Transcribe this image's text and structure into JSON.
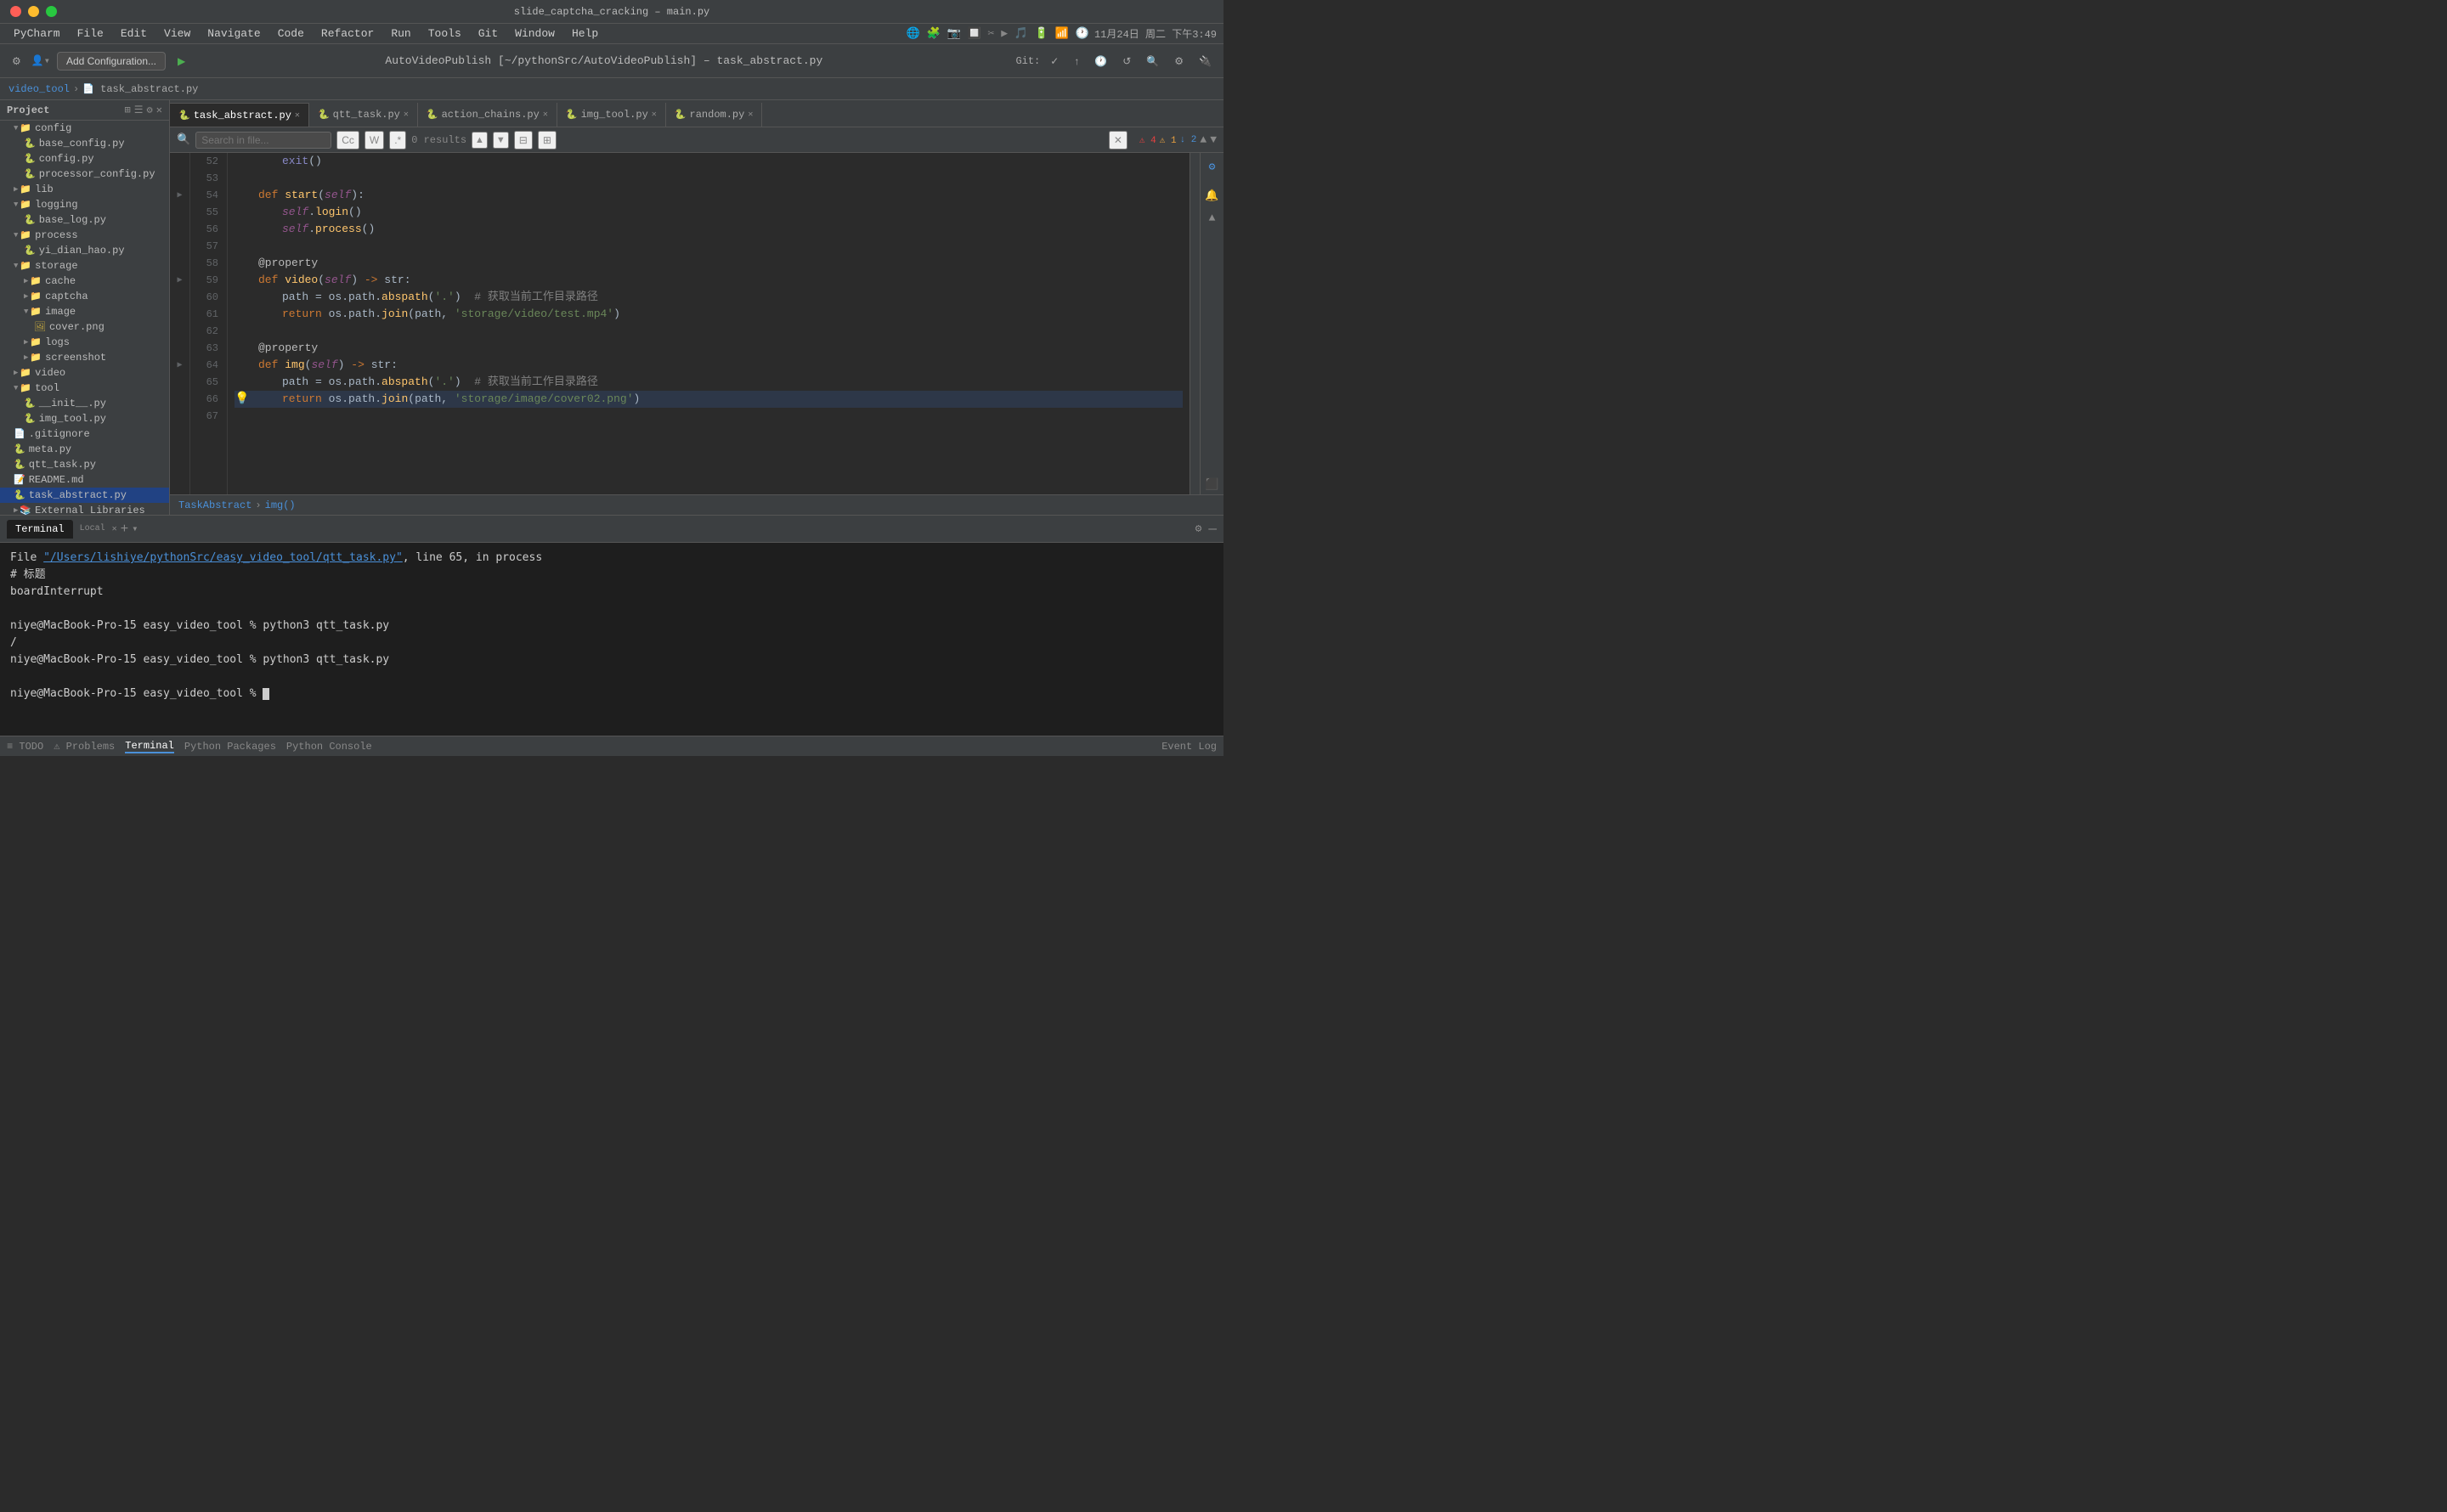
{
  "window": {
    "title": "slide_captcha_cracking – main.py",
    "subtitle": "AutoVideoPublish [~/pythonSrc/AutoVideoPublish] – task_abstract.py"
  },
  "menubar": {
    "app": "PyCharm",
    "items": [
      "File",
      "Edit",
      "View",
      "Navigate",
      "Code",
      "Refactor",
      "Run",
      "Tools",
      "Git",
      "Window",
      "Help"
    ]
  },
  "toolbar": {
    "title": "AutoVideoPublish [~/pythonSrc/AutoVideoPublish] – task_abstract.py",
    "config_label": "Add Configuration...",
    "git_label": "Git:"
  },
  "breadcrumb": {
    "parent": "video_tool",
    "current": "task_abstract.py"
  },
  "tabs": [
    {
      "label": "task_abstract.py",
      "active": true
    },
    {
      "label": "qtt_task.py",
      "active": false
    },
    {
      "label": "action_chains.py",
      "active": false
    },
    {
      "label": "img_tool.py",
      "active": false
    },
    {
      "label": "random.py",
      "active": false
    }
  ],
  "search": {
    "placeholder": "🔍",
    "results": "0 results"
  },
  "sidebar": {
    "project_label": "Project",
    "items": [
      {
        "indent": 1,
        "type": "folder-open",
        "label": "config",
        "depth": 1
      },
      {
        "indent": 2,
        "type": "file-py",
        "label": "base_config.py",
        "depth": 2
      },
      {
        "indent": 2,
        "type": "file-py",
        "label": "config.py",
        "depth": 2
      },
      {
        "indent": 2,
        "type": "file-py",
        "label": "processor_config.py",
        "depth": 2
      },
      {
        "indent": 1,
        "type": "folder-closed",
        "label": "lib",
        "depth": 1
      },
      {
        "indent": 1,
        "type": "folder-open",
        "label": "logging",
        "depth": 1
      },
      {
        "indent": 2,
        "type": "file-py",
        "label": "base_log.py",
        "depth": 2
      },
      {
        "indent": 1,
        "type": "folder-open",
        "label": "process",
        "depth": 1
      },
      {
        "indent": 2,
        "type": "file-py",
        "label": "yi_dian_hao.py",
        "depth": 2
      },
      {
        "indent": 1,
        "type": "folder-open",
        "label": "storage",
        "depth": 1
      },
      {
        "indent": 2,
        "type": "folder-closed",
        "label": "cache",
        "depth": 2
      },
      {
        "indent": 2,
        "type": "folder-closed",
        "label": "captcha",
        "depth": 2
      },
      {
        "indent": 2,
        "type": "folder-open",
        "label": "image",
        "depth": 2
      },
      {
        "indent": 3,
        "type": "file-img",
        "label": "cover.png",
        "depth": 3
      },
      {
        "indent": 2,
        "type": "folder-closed",
        "label": "logs",
        "depth": 2
      },
      {
        "indent": 2,
        "type": "folder-closed",
        "label": "screenshot",
        "depth": 2
      },
      {
        "indent": 1,
        "type": "folder-closed",
        "label": "video",
        "depth": 1
      },
      {
        "indent": 1,
        "type": "folder-open",
        "label": "tool",
        "depth": 1
      },
      {
        "indent": 2,
        "type": "file-py",
        "label": "__init__.py",
        "depth": 2
      },
      {
        "indent": 2,
        "type": "file-py",
        "label": "img_tool.py",
        "depth": 2
      },
      {
        "indent": 1,
        "type": "file-git",
        "label": ".gitignore",
        "depth": 1
      },
      {
        "indent": 1,
        "type": "file-py",
        "label": "meta.py",
        "depth": 1
      },
      {
        "indent": 1,
        "type": "file-py",
        "label": "qtt_task.py",
        "depth": 1
      },
      {
        "indent": 1,
        "type": "file-md",
        "label": "README.md",
        "depth": 1
      },
      {
        "indent": 1,
        "type": "file-py",
        "label": "task_abstract.py",
        "depth": 1,
        "selected": true
      },
      {
        "indent": 1,
        "type": "folder-closed",
        "label": "External Libraries",
        "depth": 1
      }
    ]
  },
  "code": {
    "lines": [
      {
        "num": 52,
        "content": "        exit()"
      },
      {
        "num": 53,
        "content": ""
      },
      {
        "num": 54,
        "content": "    def start(self):"
      },
      {
        "num": 55,
        "content": "        self.login()"
      },
      {
        "num": 56,
        "content": "        self.process()"
      },
      {
        "num": 57,
        "content": ""
      },
      {
        "num": 58,
        "content": "    @property"
      },
      {
        "num": 59,
        "content": "    def video(self) -> str:"
      },
      {
        "num": 60,
        "content": "        path = os.path.abspath('.')  # 获取当前工作目录路径"
      },
      {
        "num": 61,
        "content": "        return os.path.join(path, 'storage/video/test.mp4')"
      },
      {
        "num": 62,
        "content": ""
      },
      {
        "num": 63,
        "content": "    @property"
      },
      {
        "num": 64,
        "content": "    def img(self) -> str:"
      },
      {
        "num": 65,
        "content": "        path = os.path.abspath('.')  # 获取当前工作目录路径"
      },
      {
        "num": 66,
        "content": "        return os.path.join(path, 'storage/image/cover02.png')"
      },
      {
        "num": 67,
        "content": ""
      }
    ]
  },
  "status_breadcrumb": {
    "class": "TaskAbstract",
    "method": "img()"
  },
  "terminal": {
    "tabs": [
      {
        "label": "Terminal",
        "active": true
      },
      {
        "label": "Local",
        "active": true
      }
    ],
    "add_label": "+",
    "content_lines": [
      {
        "text": "File \"/Users/lishiye/pythonSrc/easy_video_tool/qtt_task.py\", line 65, in process",
        "has_link": true,
        "link": "/Users/lishiye/pythonSrc/easy_video_tool/qtt_task.py"
      },
      {
        "text": "# 标题",
        "has_link": false
      },
      {
        "text": "boardInterrupt",
        "has_link": false
      },
      {
        "text": "",
        "has_link": false
      },
      {
        "text": "niye@MacBook-Pro-15 easy_video_tool % python3 qtt_task.py",
        "has_link": false
      },
      {
        "text": "/",
        "has_link": false
      },
      {
        "text": "niye@MacBook-Pro-15 easy_video_tool % python3 qtt_task.py",
        "has_link": false
      },
      {
        "text": "",
        "has_link": false
      },
      {
        "text": "niye@MacBook-Pro-15 easy_video_tool % ",
        "has_link": false,
        "is_prompt": true
      }
    ]
  },
  "bottom_bar": {
    "items": [
      "≡ TODO",
      "⚠ Problems",
      "Terminal",
      "Python Packages",
      "Python Console",
      "Event Log"
    ]
  },
  "warnings": {
    "errors": "4",
    "warnings1": "1",
    "warnings2": "2"
  }
}
